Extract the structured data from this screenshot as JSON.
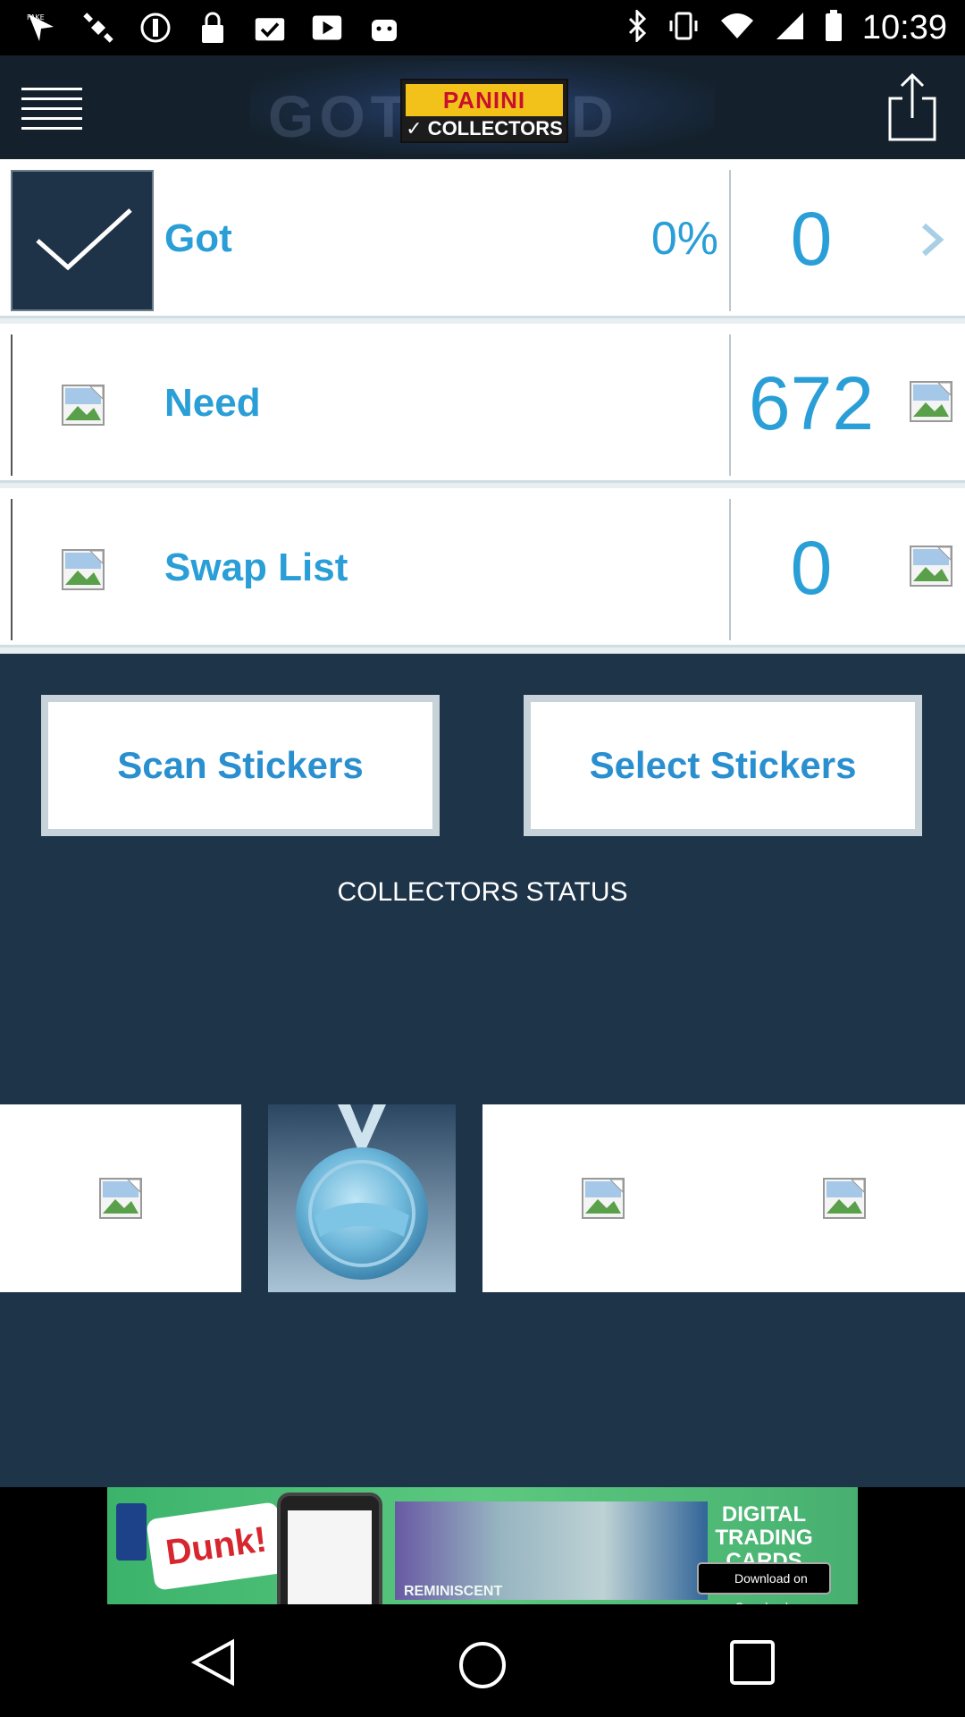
{
  "status_bar": {
    "time": "10:39",
    "left_icons": [
      "fake-gps-icon",
      "satellite-icon",
      "dnd-icon",
      "lock-icon",
      "task-check-icon",
      "play-icon",
      "android-icon"
    ],
    "right_icons": [
      "bluetooth-icon",
      "vibrate-icon",
      "wifi-icon",
      "signal-icon",
      "battery-icon"
    ]
  },
  "header": {
    "logo_top": "PANINI",
    "logo_bottom": "✓ COLLECTORS",
    "background_ghost": "GOT  NEED"
  },
  "rows": [
    {
      "label": "Got",
      "percent": "0%",
      "count": "0"
    },
    {
      "label": "Need",
      "count": "672"
    },
    {
      "label": "Swap List",
      "count": "0"
    }
  ],
  "actions": {
    "scan_label": "Scan Stickers",
    "select_label": "Select Stickers"
  },
  "collectors_status": {
    "title": "COLLECTORS STATUS",
    "badges": [
      "badge-image-1",
      "medal-badge",
      "badge-image-3",
      "badge-image-4"
    ]
  },
  "ad": {
    "brand": "Dunk!",
    "caption": "REMINISCENT",
    "headline": "DIGITAL TRADING CARDS",
    "store_badge": "Download on Google play"
  },
  "colors": {
    "accent_blue": "#2a9ed6",
    "panel_blue": "#1e3448",
    "header_dark": "#14212c"
  }
}
